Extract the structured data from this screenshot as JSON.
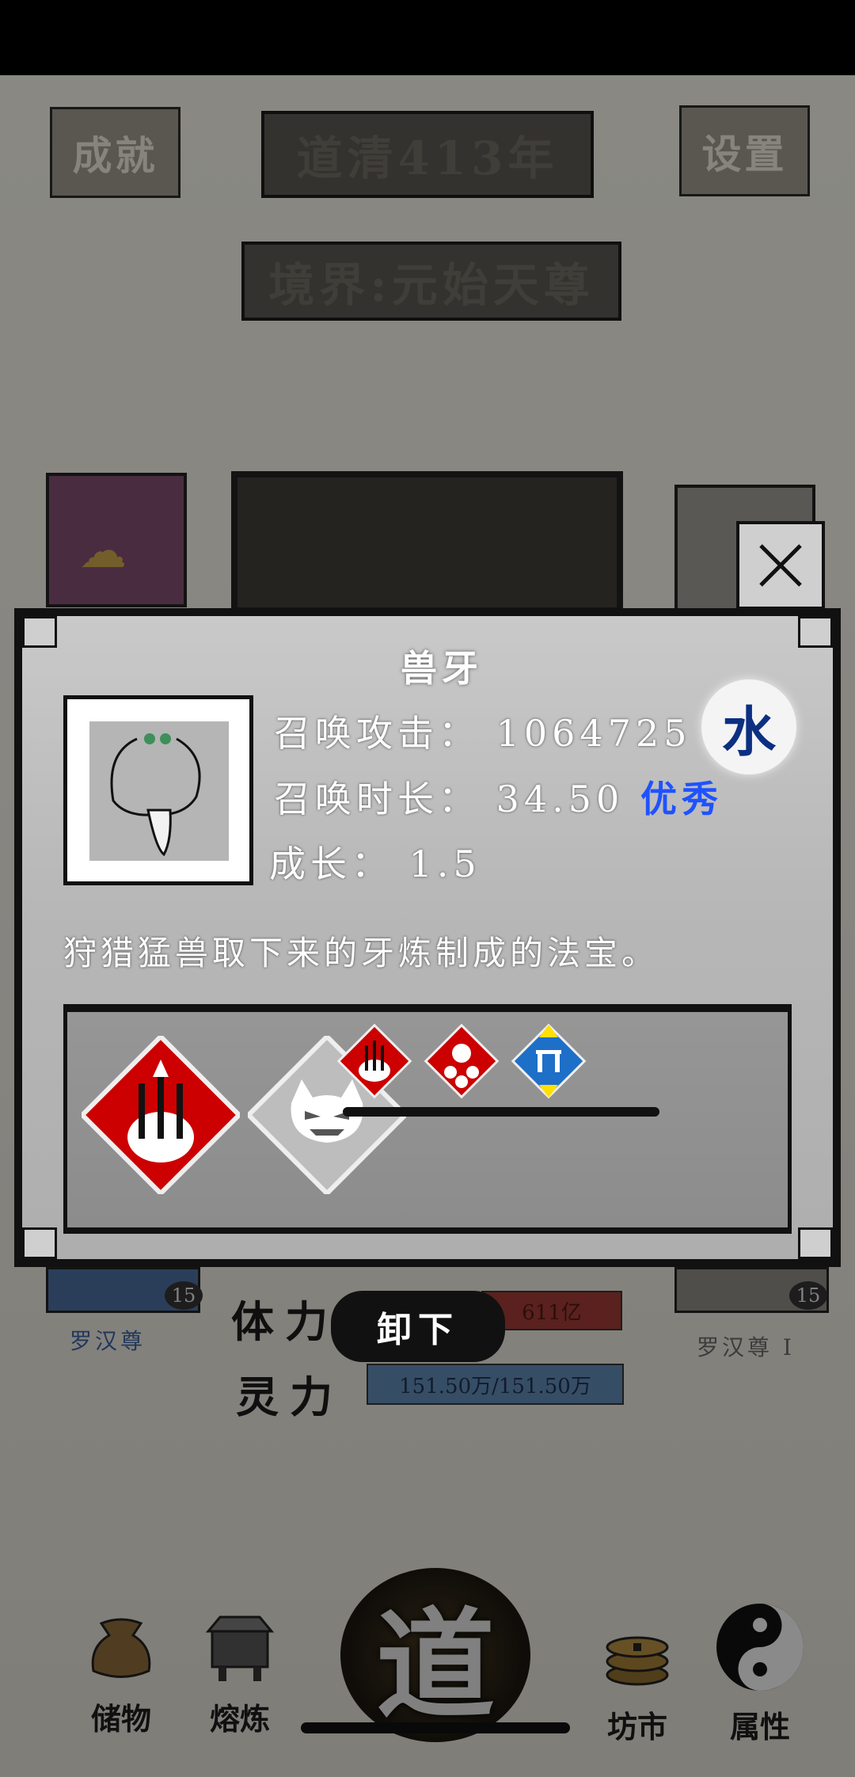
{
  "header": {
    "achievements_label": "成就",
    "year_title": "道清413年",
    "settings_label": "设置",
    "realm_title": "境界:元始天尊"
  },
  "stats_behind": {
    "stamina_label": "体力",
    "stamina_value": "611亿",
    "spirit_label": "灵力",
    "spirit_value": "151.50万/151.50万",
    "left_level": "15",
    "right_level": "15",
    "left_name": "罗汉尊",
    "right_name": "罗汉尊 I"
  },
  "dialog": {
    "item_name": "兽牙",
    "stats": [
      {
        "label": "召唤攻击",
        "sep": "：",
        "value": "1064725",
        "grade": ""
      },
      {
        "label": "召唤时长",
        "sep": "：",
        "value": "34.50",
        "grade": "优秀"
      },
      {
        "label": "成长",
        "sep": "：",
        "value": "1.5",
        "grade": ""
      }
    ],
    "element": "水",
    "description": "狩猎猛兽取下来的牙炼制成的法宝。",
    "colors": {
      "grade": "#1f52ff",
      "element": "#0c2f82",
      "skill_red": "#cc0000",
      "skill_gray": "#bdbdbd",
      "skill_blue": "#1e6fc8",
      "skill_yellow": "#ffe000"
    },
    "skills_main": [
      {
        "icon": "summon-swords-skill-icon"
      },
      {
        "icon": "demon-face-skill-icon"
      }
    ],
    "skills_small": [
      {
        "icon": "summon-swords-small-icon"
      },
      {
        "icon": "summon-demons-small-icon"
      },
      {
        "icon": "stat-up-down-small-icon"
      }
    ]
  },
  "actions": {
    "unequip_label": "卸下"
  },
  "nav": {
    "items": [
      {
        "label": "储物",
        "icon": "pouch-icon"
      },
      {
        "label": "熔炼",
        "icon": "furnace-icon"
      },
      {
        "label": "道",
        "icon": "dao-emblem-icon"
      },
      {
        "label": "坊市",
        "icon": "coins-icon"
      },
      {
        "label": "属性",
        "icon": "yin-yang-icon"
      }
    ]
  }
}
